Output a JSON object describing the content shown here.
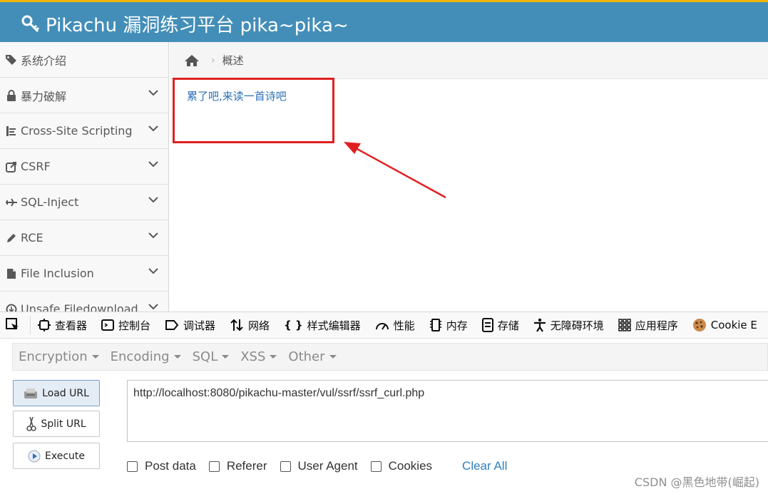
{
  "header": {
    "title": "Pikachu 漏洞练习平台 pika~pika~"
  },
  "sidebar": {
    "items": [
      {
        "label": "系统介绍",
        "icon": "tags-icon",
        "chevron": false
      },
      {
        "label": "暴力破解",
        "icon": "lock-icon",
        "chevron": true
      },
      {
        "label": "Cross-Site Scripting",
        "icon": "sitemap-icon",
        "chevron": true
      },
      {
        "label": "CSRF",
        "icon": "share-icon",
        "chevron": true
      },
      {
        "label": "SQL-Inject",
        "icon": "plane-icon",
        "chevron": true
      },
      {
        "label": "RCE",
        "icon": "pencil-icon",
        "chevron": true
      },
      {
        "label": "File Inclusion",
        "icon": "file-icon",
        "chevron": true
      },
      {
        "label": "Unsafe Filedownload",
        "icon": "download-icon",
        "chevron": true
      }
    ]
  },
  "breadcrumb": {
    "home_icon": "home-icon",
    "current": "概述"
  },
  "content": {
    "text": "累了吧,来读一首诗吧"
  },
  "annotation": {
    "box_color": "#e02020",
    "arrow_color": "#e02020"
  },
  "devtools": {
    "tabs": [
      {
        "label": "查看器",
        "icon": "inspector-icon"
      },
      {
        "label": "控制台",
        "icon": "console-icon"
      },
      {
        "label": "调试器",
        "icon": "debugger-icon"
      },
      {
        "label": "网络",
        "icon": "network-icon"
      },
      {
        "label": "样式编辑器",
        "icon": "style-editor-icon"
      },
      {
        "label": "性能",
        "icon": "performance-icon"
      },
      {
        "label": "内存",
        "icon": "memory-icon"
      },
      {
        "label": "存储",
        "icon": "storage-icon"
      },
      {
        "label": "无障碍环境",
        "icon": "accessibility-icon"
      },
      {
        "label": "应用程序",
        "icon": "application-icon"
      },
      {
        "label": "Cookie E",
        "icon": "cookie-icon"
      }
    ]
  },
  "hackbar": {
    "menus": [
      "Encryption",
      "Encoding",
      "SQL",
      "XSS",
      "Other"
    ],
    "buttons": {
      "load": "Load URL",
      "split": "Split URL",
      "execute": "Execute"
    },
    "url": "http://localhost:8080/pikachu-master/vul/ssrf/ssrf_curl.php",
    "options": [
      "Post data",
      "Referer",
      "User Agent",
      "Cookies"
    ],
    "clear_all": "Clear All"
  },
  "watermark": "CSDN @黑色地带(崛起)",
  "colors": {
    "header_bg": "#438eb9",
    "header_accent": "#f0b400",
    "link": "#2a6fb5"
  }
}
